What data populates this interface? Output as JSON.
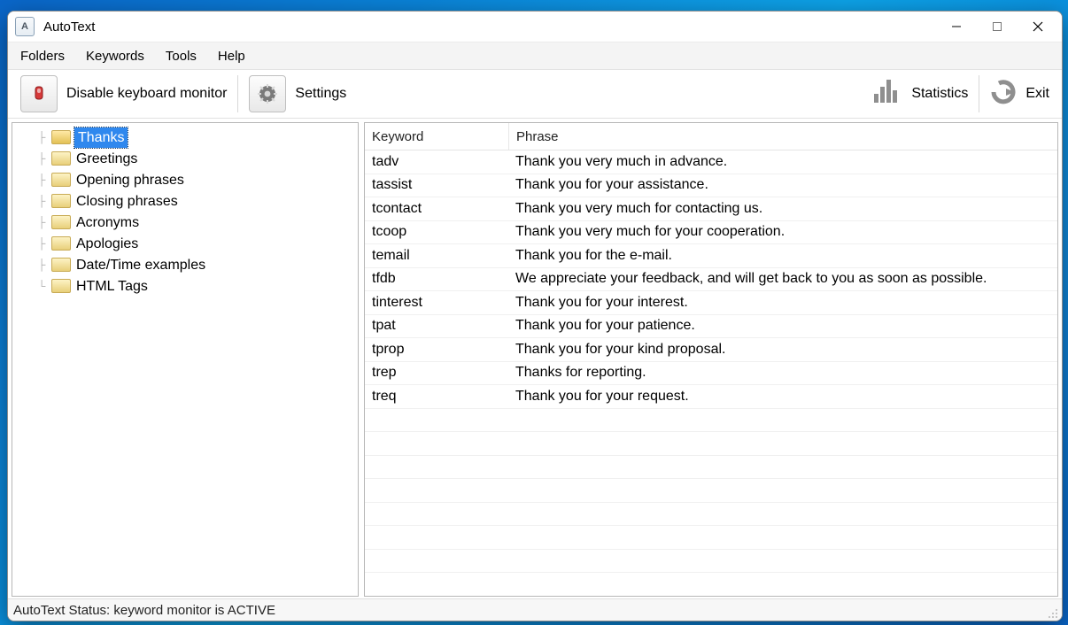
{
  "window": {
    "title": "AutoText"
  },
  "menubar": [
    "Folders",
    "Keywords",
    "Tools",
    "Help"
  ],
  "toolbar": {
    "disable_monitor": "Disable keyboard monitor",
    "settings": "Settings",
    "statistics": "Statistics",
    "exit": "Exit"
  },
  "folders": [
    {
      "name": "Thanks",
      "selected": true
    },
    {
      "name": "Greetings",
      "selected": false
    },
    {
      "name": "Opening phrases",
      "selected": false
    },
    {
      "name": "Closing phrases",
      "selected": false
    },
    {
      "name": "Acronyms",
      "selected": false
    },
    {
      "name": "Apologies",
      "selected": false
    },
    {
      "name": "Date/Time examples",
      "selected": false
    },
    {
      "name": "HTML Tags",
      "selected": false
    }
  ],
  "table": {
    "columns": [
      "Keyword",
      "Phrase"
    ],
    "rows": [
      {
        "keyword": "tadv",
        "phrase": "Thank you very much in advance."
      },
      {
        "keyword": "tassist",
        "phrase": "Thank you for your assistance."
      },
      {
        "keyword": "tcontact",
        "phrase": "Thank you very much for contacting us."
      },
      {
        "keyword": "tcoop",
        "phrase": "Thank you very much for your cooperation."
      },
      {
        "keyword": "temail",
        "phrase": "Thank you for the e-mail."
      },
      {
        "keyword": "tfdb",
        "phrase": "We appreciate your feedback, and will get back to you as soon as possible."
      },
      {
        "keyword": "tinterest",
        "phrase": "Thank you for your interest."
      },
      {
        "keyword": "tpat",
        "phrase": "Thank you for your patience."
      },
      {
        "keyword": "tprop",
        "phrase": "Thank you for your kind proposal."
      },
      {
        "keyword": "trep",
        "phrase": "Thanks for reporting."
      },
      {
        "keyword": "treq",
        "phrase": "Thank you for your request."
      }
    ],
    "blank_rows": 8
  },
  "statusbar": {
    "text": "AutoText Status: keyword monitor is ACTIVE"
  }
}
